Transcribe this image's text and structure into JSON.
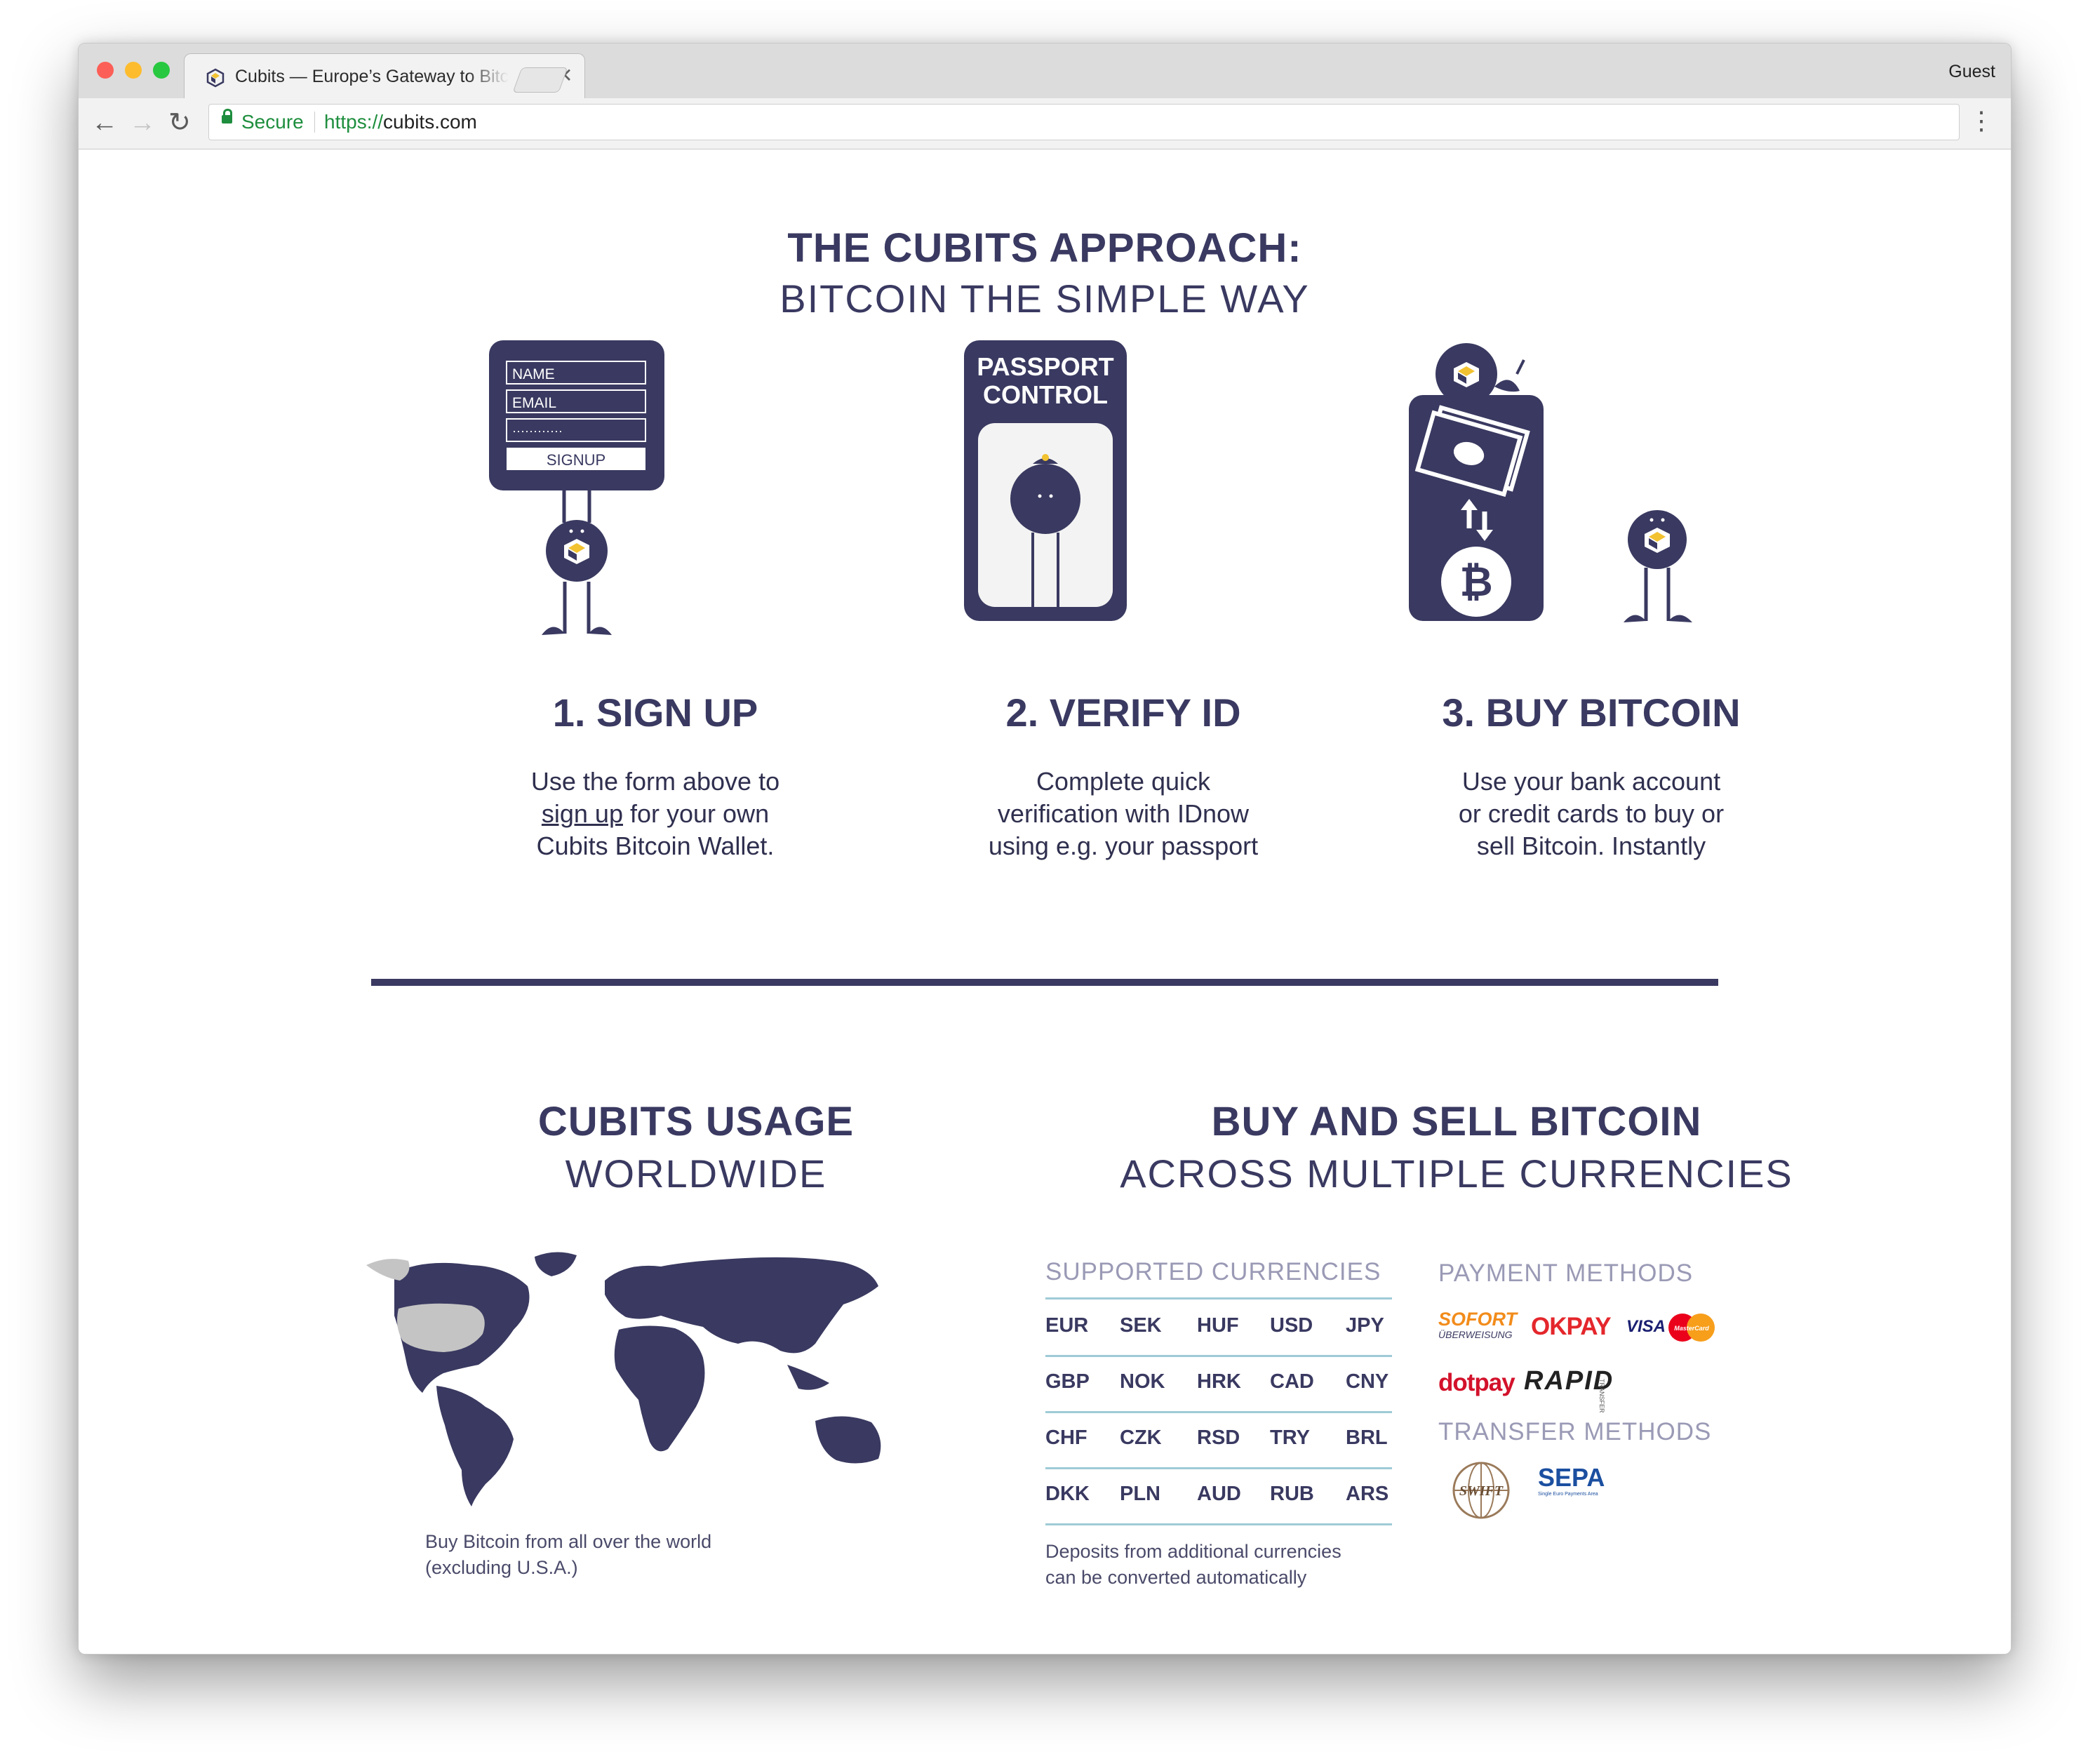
{
  "browser": {
    "tab_title": "Cubits — Europe’s Gateway to Bitcoin",
    "tab_close": "✕",
    "profile": "Guest",
    "secure_label": "Secure",
    "url_scheme": "https://",
    "url_host": "cubits.com",
    "back_icon": "←",
    "forward_icon": "→",
    "reload_icon": "↻",
    "menu_icon": "⋮"
  },
  "approach": {
    "title": "THE CUBITS APPROACH:",
    "subtitle": "BITCOIN THE SIMPLE WAY"
  },
  "signup_form": {
    "name": "NAME",
    "email": "EMAIL",
    "password": "············",
    "button": "SIGNUP"
  },
  "passport_sign": {
    "line1": "PASSPORT",
    "line2": "CONTROL"
  },
  "steps": [
    {
      "title": "1. SIGN UP",
      "desc_before": "Use the form above to",
      "desc_link": "sign up",
      "desc_after": "for your own",
      "desc_last": "Cubits Bitcoin Wallet."
    },
    {
      "title": "2. VERIFY ID",
      "line1": "Complete quick",
      "line2": "verification with IDnow",
      "line3": "using e.g. your passport"
    },
    {
      "title": "3. BUY BITCOIN",
      "line1": "Use your bank account",
      "line2": "or credit cards to buy or",
      "line3": "sell Bitcoin. Instantly"
    }
  ],
  "usage": {
    "title": "CUBITS USAGE",
    "subtitle": "WORLDWIDE",
    "caption_line1": "Buy Bitcoin from all over the world",
    "caption_line2": "(excluding U.S.A.)"
  },
  "currencies": {
    "title": "BUY AND SELL BITCOIN",
    "subtitle": "ACROSS MULTIPLE CURRENCIES",
    "supported_heading": "SUPPORTED CURRENCIES",
    "rows": [
      [
        "EUR",
        "SEK",
        "HUF",
        "USD",
        "JPY"
      ],
      [
        "GBP",
        "NOK",
        "HRK",
        "CAD",
        "CNY"
      ],
      [
        "CHF",
        "CZK",
        "RSD",
        "TRY",
        "BRL"
      ],
      [
        "DKK",
        "PLN",
        "AUD",
        "RUB",
        "ARS"
      ]
    ],
    "note_line1": "Deposits from additional currencies",
    "note_line2": "can be converted automatically"
  },
  "payment": {
    "heading": "PAYMENT METHODS",
    "sofort": "SOFORT",
    "sofort_sub": "ÜBERWEISUNG",
    "okpay": "OKPAY",
    "visa": "VISA",
    "mastercard": "MasterCard",
    "dotpay": "dotpay",
    "rapid": "RAPID",
    "rapid_sub": "TRANSFER"
  },
  "transfer": {
    "heading": "TRANSFER METHODS",
    "swift": "SWIFT",
    "sepa": "SEPA",
    "sepa_sub": "Single Euro Payments Area"
  },
  "colors": {
    "navy": "#393961",
    "gold": "#f2c230",
    "secure_green": "#1e8e3e",
    "divider_cyan": "#9fcbd6"
  },
  "icons": {
    "cubits": "cubits-logo-icon",
    "bitcoin": "bitcoin-icon",
    "cash": "cash-icon",
    "exchange": "exchange-arrows-icon"
  }
}
